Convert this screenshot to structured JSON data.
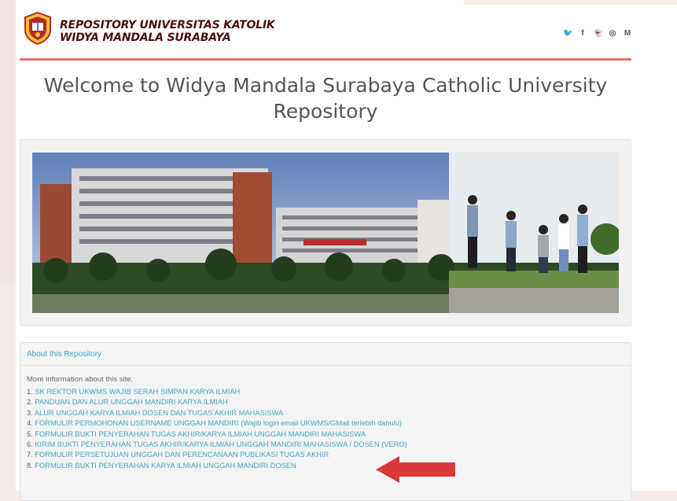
{
  "header": {
    "brand_line1": "REPOSITORY UNIVERSITAS KATOLIK",
    "brand_line2": "WIDYA MANDALA SURABAYA",
    "social": [
      {
        "icon": "twitter-icon",
        "glyph": "🐦"
      },
      {
        "icon": "facebook-icon",
        "glyph": "f"
      },
      {
        "icon": "snapchat-icon",
        "glyph": "👻"
      },
      {
        "icon": "instagram-icon",
        "glyph": "◎"
      },
      {
        "icon": "medium-icon",
        "glyph": "M"
      }
    ]
  },
  "welcome": {
    "line1": "Welcome to Widya Mandala Surabaya Catholic University",
    "line2": "Repository"
  },
  "about": {
    "title": "About this Repository",
    "intro": "More information about this site.",
    "items": [
      {
        "num": "1.",
        "label": "SK REKTOR UKWMS WAJIB SERAH SIMPAN KARYA ILMIAH"
      },
      {
        "num": "2.",
        "label": "PANDUAN DAN ALUR UNGGAH MANDIRI KARYA ILMIAH"
      },
      {
        "num": "3.",
        "label": "ALUR UNGGAH KARYA ILMIAH DOSEN DAN TUGAS AKHIR MAHASISWA"
      },
      {
        "num": "4.",
        "label": "FORMULIR PERMOHONAN USERNAME UNGGAH MANDIRI (Wajib login email UKWMS/GMail terlebih dahulu)"
      },
      {
        "num": "5.",
        "label": "FORMULIR BUKTI PENYERAHAN TUGAS AKHIR/KARYA ILMIAH UNGGAH MANDIRI MAHASISWA"
      },
      {
        "num": "6.",
        "label": "KIRIM BUKTI PENYERAHAN TUGAS AKHIR/KARYA ILMIAH UNGGAH MANDIRI MAHASISWA / DOSEN (VERO)"
      },
      {
        "num": "7.",
        "label": "FORMULIR PERSETUJUAN UNGGAH DAN PERENCANAAN PUBLIKASI TUGAS AKHIR"
      },
      {
        "num": "8.",
        "label": "FORMULIR BUKTI PENYERAHAN KARYA ILMIAH UNGGAH MANDIRI DOSEN"
      }
    ]
  },
  "colors": {
    "accent_red": "#e9706a",
    "link": "#3fa7c4",
    "brand": "#4a1012",
    "arrow": "#d9393b"
  }
}
